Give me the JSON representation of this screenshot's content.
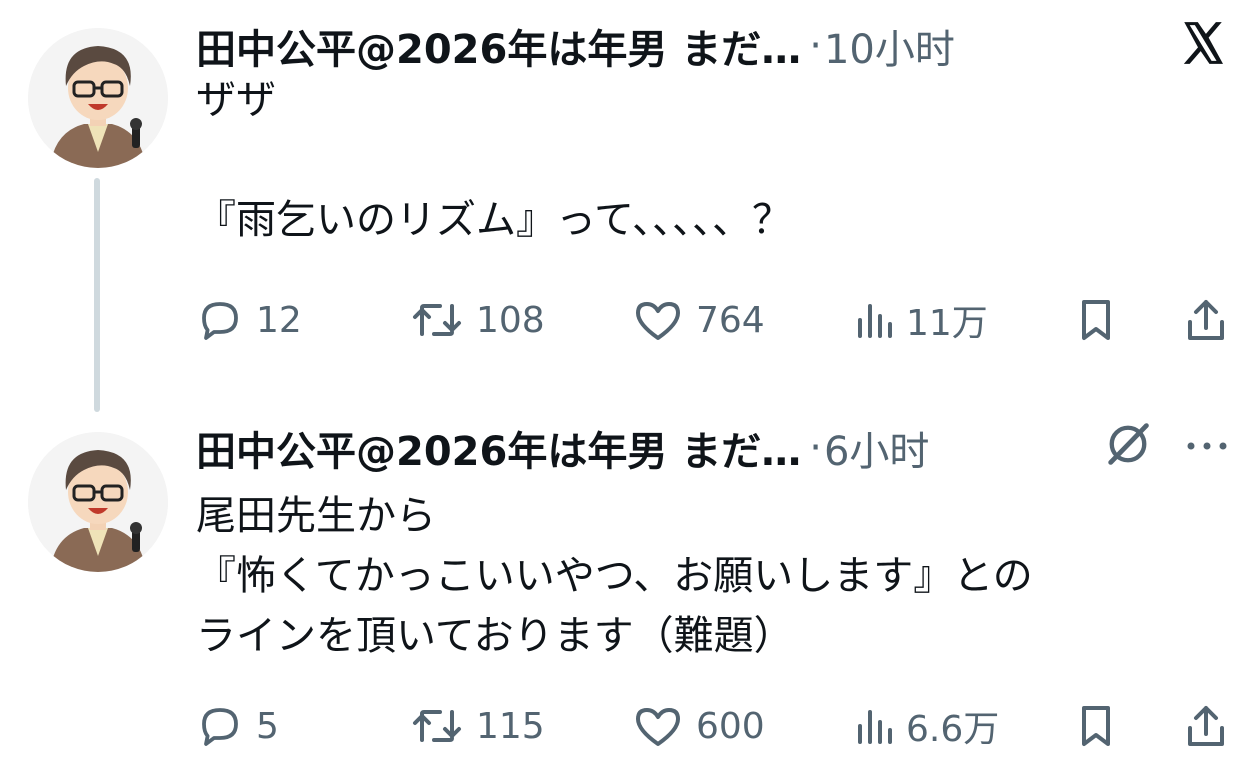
{
  "tweets": [
    {
      "author_display": "田中公平@2026年は年男 まだ…",
      "separator": "·",
      "time": "10小时",
      "text_lines": [
        "ザザ",
        "",
        "『雨乞いのリズム』って、、、、、？"
      ],
      "stats": {
        "replies": "12",
        "retweets": "108",
        "likes": "764",
        "views": "11万"
      }
    },
    {
      "author_display": "田中公平@2026年は年男 まだ…",
      "separator": "·",
      "time": "6小时",
      "text_lines": [
        "尾田先生から",
        "『怖くてかっこいいやつ、お願いします』との",
        "ラインを頂いております（難題）"
      ],
      "stats": {
        "replies": "5",
        "retweets": "115",
        "likes": "600",
        "views": "6.6万"
      }
    }
  ],
  "icons": {
    "platform_logo": "x-logo-icon",
    "grok": "grok-icon",
    "more": "more-dots-icon",
    "reply": "reply-bubble-icon",
    "retweet": "retweet-arrows-icon",
    "like": "heart-icon",
    "views": "bar-chart-icon",
    "bookmark": "bookmark-icon",
    "share": "share-upload-icon"
  },
  "colors": {
    "text": "#0f1419",
    "secondary": "#536471",
    "thread_line": "#cfd9de",
    "background": "#ffffff"
  }
}
